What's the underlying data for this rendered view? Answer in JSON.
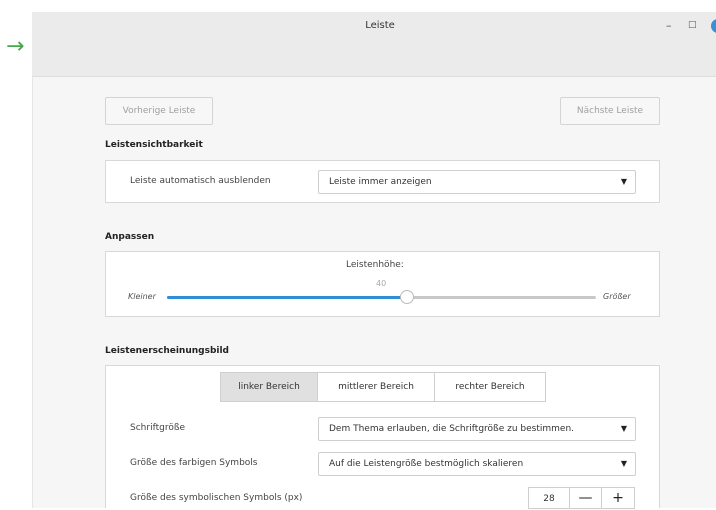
{
  "window": {
    "title": "Leiste",
    "minimize_glyph": "–",
    "maximize_glyph": "□"
  },
  "nav": {
    "prev_label": "Vorherige Leiste",
    "next_label": "Nächste Leiste"
  },
  "visibility": {
    "section_title": "Leistensichtbarkeit",
    "autohide_label": "Leiste automatisch ausblenden",
    "autohide_value": "Leiste immer anzeigen"
  },
  "customize": {
    "section_title": "Anpassen",
    "slider_title": "Leistenhöhe:",
    "slider_value": "40",
    "slider_fraction": 0.56,
    "min_label": "Kleiner",
    "max_label": "Größer"
  },
  "appearance": {
    "section_title": "Leistenerscheinungsbild",
    "tabs": [
      {
        "label": "linker Bereich",
        "active": true
      },
      {
        "label": "mittlerer Bereich",
        "active": false
      },
      {
        "label": "rechter Bereich",
        "active": false
      }
    ],
    "font_size_label": "Schriftgröße",
    "font_size_value": "Dem Thema erlauben, die Schriftgröße zu bestimmen.",
    "color_icon_label": "Größe des farbigen Symbols",
    "color_icon_value": "Auf die Leistengröße bestmöglich skalieren",
    "symbolic_icon_label": "Größe des symbolischen Symbols (px)",
    "symbolic_icon_value": "28",
    "minus_glyph": "—",
    "plus_glyph": "+"
  },
  "icons": {
    "arrow": "→",
    "caret": "▼"
  },
  "colors": {
    "accent": "#2e8fd6",
    "arrow": "#46a84a"
  }
}
